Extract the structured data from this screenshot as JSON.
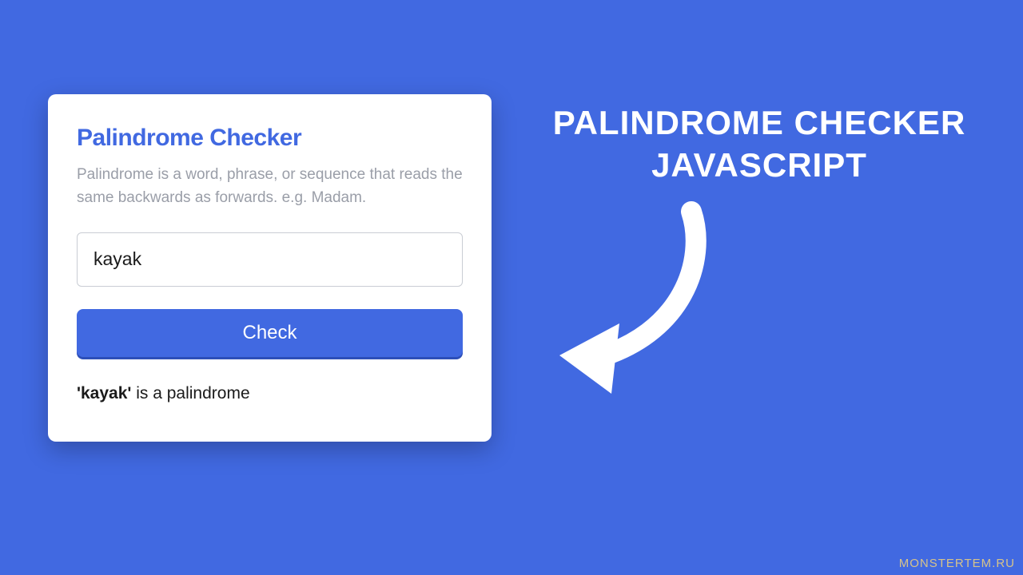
{
  "card": {
    "title": "Palindrome Checker",
    "description": "Palindrome is a word, phrase, or sequence that reads the same backwards as forwards. e.g. Madam.",
    "input_value": "kayak",
    "button_label": "Check",
    "result_word": "'kayak'",
    "result_suffix": " is a palindrome"
  },
  "headline": {
    "line1": "PALINDROME CHECKER",
    "line2": "JAVASCRIPT"
  },
  "watermark": "MONSTERTEM.RU"
}
